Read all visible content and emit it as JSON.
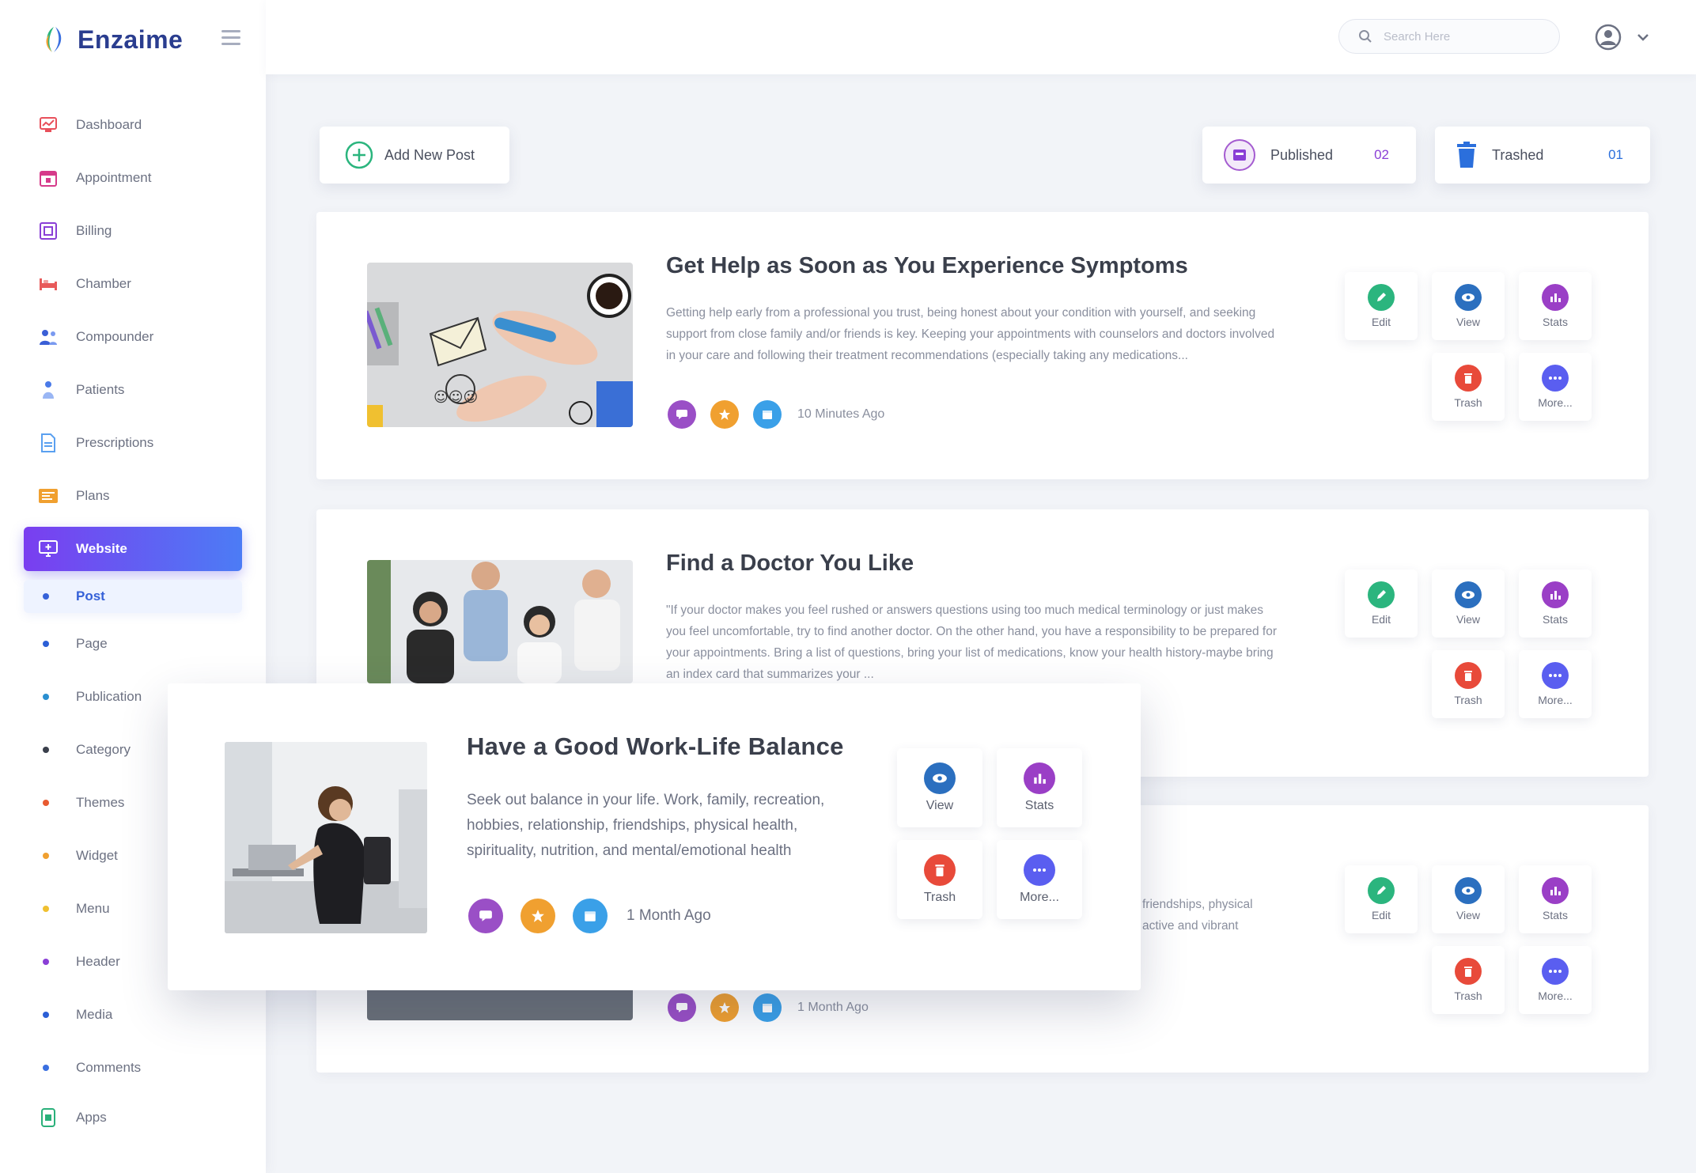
{
  "brand": {
    "name": "Enzaime"
  },
  "search": {
    "placeholder": "Search Here"
  },
  "sidebar": {
    "items": [
      {
        "label": "Dashboard",
        "color": "#e8505b",
        "icon": "dashboard-icon"
      },
      {
        "label": "Appointment",
        "color": "#d63a8a",
        "icon": "calendar-icon"
      },
      {
        "label": "Billing",
        "color": "#8a3fd6",
        "icon": "billing-icon"
      },
      {
        "label": "Chamber",
        "color": "#e85a5a",
        "icon": "bed-icon"
      },
      {
        "label": "Compounder",
        "color": "#3a5fd6",
        "icon": "people-icon"
      },
      {
        "label": "Patients",
        "color": "#4a7ae8",
        "icon": "patient-icon"
      },
      {
        "label": "Prescriptions",
        "color": "#5aa0f0",
        "icon": "document-icon"
      },
      {
        "label": "Plans",
        "color": "#f0a030",
        "icon": "plans-icon"
      },
      {
        "label": "Website",
        "color": "#ffffff",
        "icon": "website-icon"
      }
    ],
    "subitems": [
      {
        "label": "Post",
        "color": "#3561d8"
      },
      {
        "label": "Page",
        "color": "#2b5fd6"
      },
      {
        "label": "Publication",
        "color": "#2a8fd0"
      },
      {
        "label": "Category",
        "color": "#3a3f4b"
      },
      {
        "label": "Themes",
        "color": "#e85a30"
      },
      {
        "label": "Widget",
        "color": "#f0a030"
      },
      {
        "label": "Menu",
        "color": "#f0c030"
      },
      {
        "label": "Header",
        "color": "#8a3fd6"
      },
      {
        "label": "Media",
        "color": "#2b5fd6"
      },
      {
        "label": "Comments",
        "color": "#3a6fe0"
      }
    ],
    "apps": {
      "label": "Apps",
      "color": "#2ab07a",
      "icon": "apps-icon"
    }
  },
  "toolbar": {
    "add_label": "Add New Post",
    "published_label": "Published",
    "published_count": "02",
    "trashed_label": "Trashed",
    "trashed_count": "01"
  },
  "colors": {
    "edit": "#2bb57e",
    "view": "#2b6fbf",
    "stats": "#9a3fc6",
    "trash": "#e84a3a",
    "more": "#5a5ef0",
    "meta_purple": "#9a4fc6",
    "meta_orange": "#f0a030",
    "meta_blue": "#3aa0e8"
  },
  "actions": {
    "edit": "Edit",
    "view": "View",
    "stats": "Stats",
    "trash": "Trash",
    "more": "More..."
  },
  "posts": [
    {
      "title": "Get Help as Soon as You Experience Symptoms",
      "excerpt": "Getting help early from a professional you trust, being honest about your condition with yourself, and seeking support from close family and/or friends is key. Keeping your appointments with counselors and doctors involved in your care and following their treatment recommendations (especially taking any medications...",
      "time": "10 Minutes Ago"
    },
    {
      "title": "Find a Doctor You Like",
      "excerpt": "\"If your doctor makes you feel rushed or answers questions using too much medical terminology or just makes you feel uncomfortable, try to find another doctor. On the other hand, you have a responsibility to be prepared for your appointments. Bring a list of questions, bring your list of medications, know your health history-maybe bring an index card that summarizes your ...",
      "time": ""
    },
    {
      "title": "",
      "excerpt": "friendships, physical active and vibrant",
      "time": "1 Month Ago"
    }
  ],
  "focus": {
    "title": "Have a Good Work-Life Balance",
    "excerpt": "Seek out balance in your life. Work, family, recreation, hobbies, relationship, friendships, physical health, spirituality, nutrition, and mental/emotional health",
    "time": "1 Month Ago"
  }
}
